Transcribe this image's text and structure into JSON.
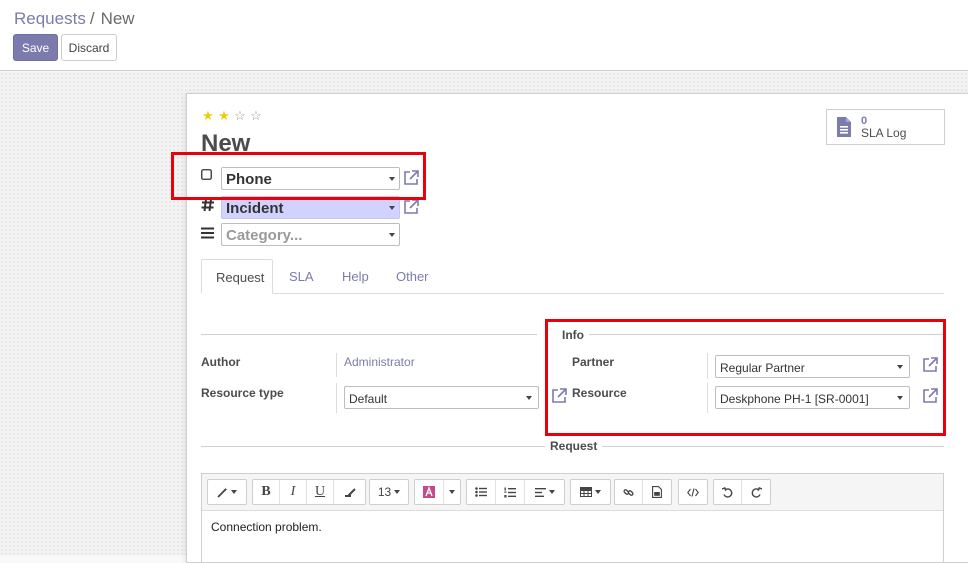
{
  "breadcrumb": {
    "parent": "Requests",
    "separator": "/",
    "current": "New"
  },
  "buttons": {
    "save": "Save",
    "discard": "Discard"
  },
  "rating": {
    "value": 2,
    "max": 4,
    "glyph_on": "★",
    "glyph_off": "☆"
  },
  "record": {
    "title": "New"
  },
  "smart_button": {
    "count": "0",
    "label": "SLA Log",
    "icon": "document-icon"
  },
  "header_fields": {
    "channel": {
      "value": "Phone",
      "icon": "checkbox-icon"
    },
    "type": {
      "value": "Incident",
      "icon": "hash-icon"
    },
    "category": {
      "placeholder": "Category...",
      "icon": "list-icon"
    }
  },
  "tabs": [
    "Request",
    "SLA",
    "Help",
    "Other"
  ],
  "sections": {
    "info": "Info",
    "request": "Request"
  },
  "fields": {
    "author": {
      "label": "Author",
      "value": "Administrator"
    },
    "resource_type": {
      "label": "Resource type",
      "value": "Default"
    },
    "partner": {
      "label": "Partner",
      "value": "Regular Partner"
    },
    "resource": {
      "label": "Resource",
      "value": "Deskphone PH-1 [SR-0001]"
    }
  },
  "editor": {
    "font_size": "13",
    "content": "Connection problem."
  },
  "colors": {
    "accent": "#7c7bad",
    "highlight": "#d2d2ff",
    "annotation": "#e8000b",
    "star": "#f3cc00"
  }
}
